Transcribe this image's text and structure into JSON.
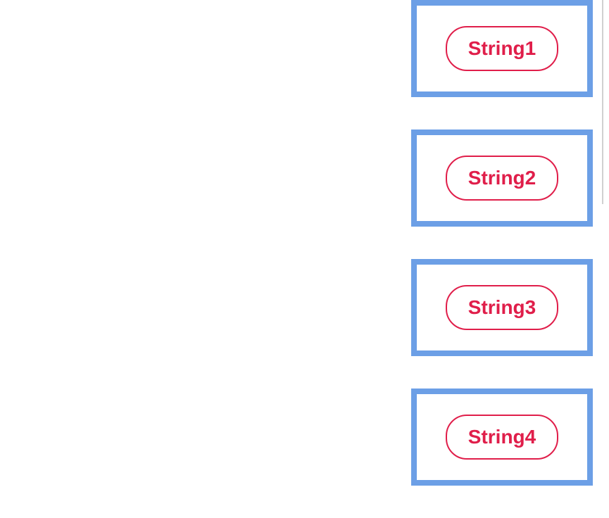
{
  "items": [
    {
      "label": "String1"
    },
    {
      "label": "String2"
    },
    {
      "label": "String3"
    },
    {
      "label": "String4"
    }
  ],
  "colors": {
    "cardBorder": "#6c9fe6",
    "badgeBorder": "#e01e4a",
    "badgeText": "#e01e4a"
  }
}
